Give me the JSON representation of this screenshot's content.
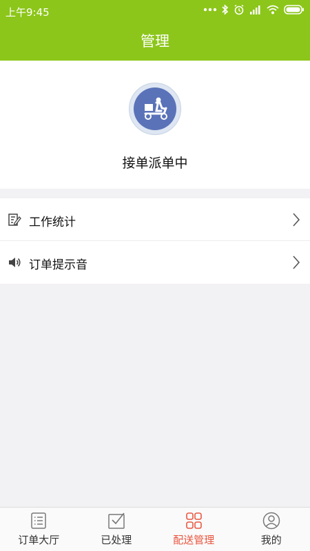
{
  "status_bar": {
    "time": "上午9:45"
  },
  "header": {
    "title": "管理"
  },
  "profile": {
    "avatar_icon": "delivery-scooter-icon",
    "status_text": "接单派单中"
  },
  "menu": {
    "items": [
      {
        "label": "工作统计",
        "icon": "edit-note-icon"
      },
      {
        "label": "订单提示音",
        "icon": "speaker-icon"
      }
    ]
  },
  "tabbar": {
    "tabs": [
      {
        "label": "订单大厅",
        "icon": "order-list-icon",
        "active": false
      },
      {
        "label": "已处理",
        "icon": "processed-icon",
        "active": false
      },
      {
        "label": "配送管理",
        "icon": "grid-icon",
        "active": true
      },
      {
        "label": "我的",
        "icon": "user-icon",
        "active": false
      }
    ]
  },
  "colors": {
    "header": "#8cc61a",
    "active_tab": "#e9553f",
    "avatar": "#5a72b8",
    "background": "#f2f1f3"
  }
}
